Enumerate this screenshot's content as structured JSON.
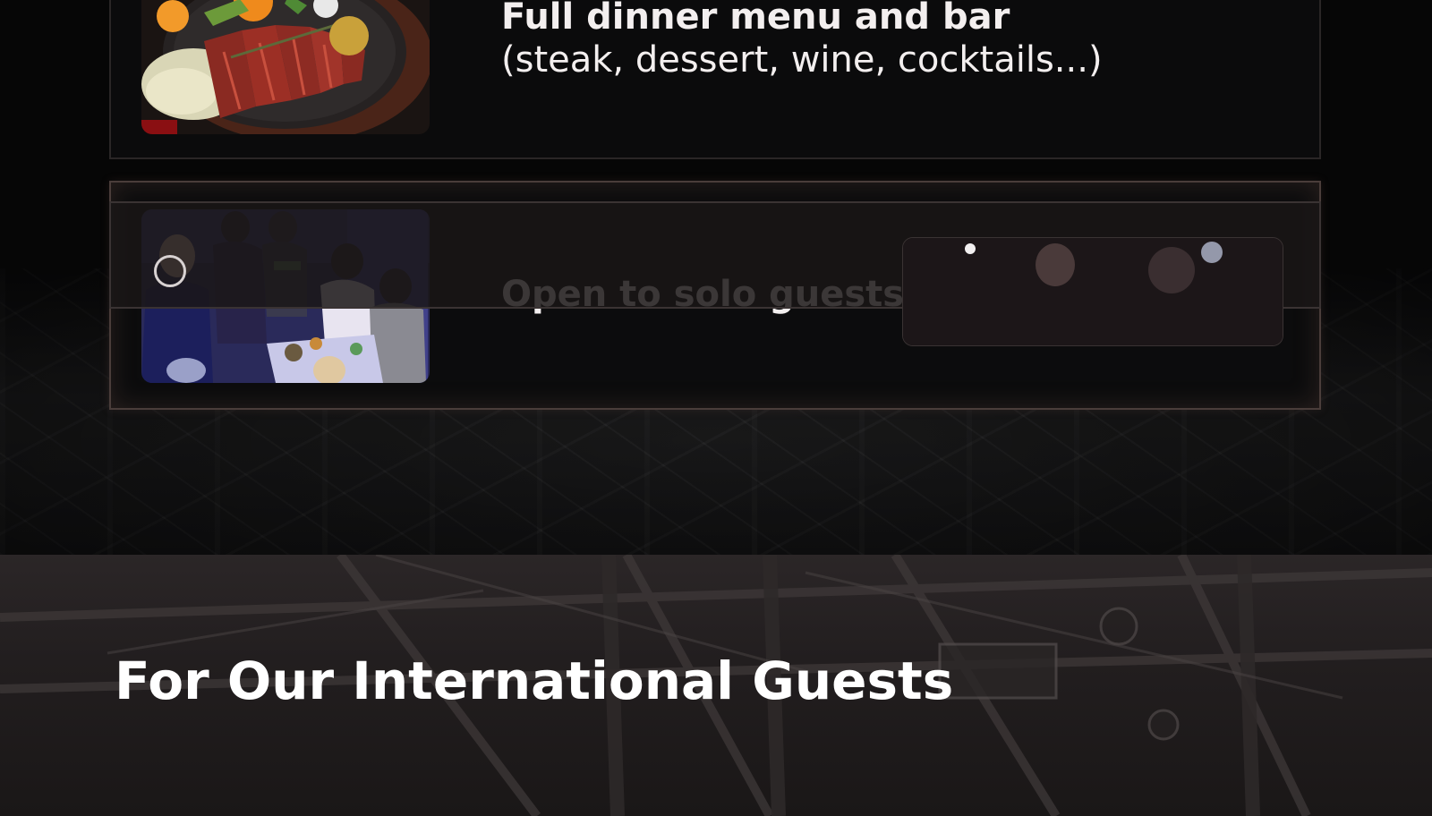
{
  "features": [
    {
      "title": "Full dinner menu and bar",
      "subtitle": "(steak, dessert, wine, cocktails...)",
      "image": "steak-dish-image"
    },
    {
      "title": "Open to solo guests, couples, families",
      "subtitle": "",
      "image": "karaoke-party-image"
    }
  ],
  "international": {
    "heading": "For Our International Guests",
    "image": "performance-photo"
  },
  "colors": {
    "background": "#060606",
    "card_border": "#2a2626",
    "card_border_highlight": "#4a3d3a",
    "text": "#f3efef"
  }
}
